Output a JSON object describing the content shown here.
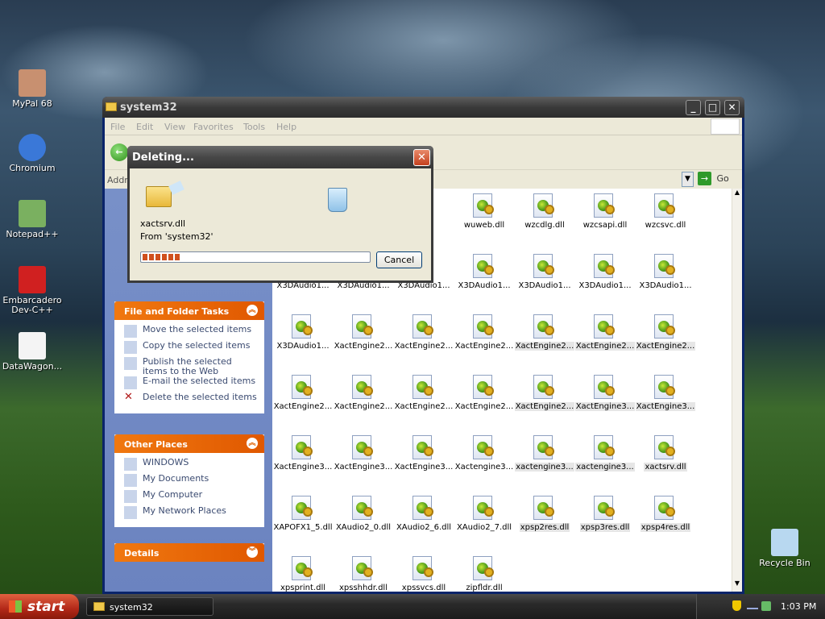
{
  "desktop": {
    "icons": [
      {
        "label": "MyPal 68",
        "icon": "mypal-icon"
      },
      {
        "label": "Chromium",
        "icon": "chromium-icon"
      },
      {
        "label": "Notepad++",
        "icon": "notepadpp-icon"
      },
      {
        "label": "Embarcadero Dev-C++",
        "icon": "devcpp-icon"
      },
      {
        "label": "DataWagon...",
        "icon": "datawagon-icon"
      },
      {
        "label": "Recycle Bin",
        "icon": "recycle-bin-icon"
      }
    ]
  },
  "window": {
    "title": "system32",
    "menu": [
      "File",
      "Edit",
      "View",
      "Favorites",
      "Tools",
      "Help"
    ],
    "address_label": "Addre",
    "go_label": "Go"
  },
  "tasks": {
    "file_folder": {
      "title": "File and Folder Tasks",
      "items": [
        "Move the selected items",
        "Copy the selected items",
        "Publish the selected items to the Web",
        "E-mail the selected items",
        "Delete the selected items"
      ]
    },
    "other_places": {
      "title": "Other Places",
      "items": [
        "WINDOWS",
        "My Documents",
        "My Computer",
        "My Network Places"
      ]
    },
    "details": {
      "title": "Details"
    }
  },
  "files": {
    "rows": [
      [
        "",
        "",
        "",
        "wuweb.dll",
        "wzcdlg.dll",
        "wzcsapi.dll",
        "wzcsvc.dll"
      ],
      [
        "X3DAudio1...",
        "X3DAudio1...",
        "X3DAudio1...",
        "X3DAudio1...",
        "X3DAudio1...",
        "X3DAudio1...",
        "X3DAudio1..."
      ],
      [
        "X3DAudio1...",
        "XactEngine2...",
        "XactEngine2...",
        "XactEngine2...",
        "XactEngine2...",
        "XactEngine2...",
        "XactEngine2..."
      ],
      [
        "XactEngine2...",
        "XactEngine2...",
        "XactEngine2...",
        "XactEngine2...",
        "XactEngine2...",
        "XactEngine3...",
        "XactEngine3..."
      ],
      [
        "XactEngine3...",
        "XactEngine3...",
        "XactEngine3...",
        "Xactengine3...",
        "xactengine3...",
        "xactengine3...",
        "xactsrv.dll"
      ],
      [
        "XAPOFX1_5.dll",
        "XAudio2_0.dll",
        "XAudio2_6.dll",
        "XAudio2_7.dll",
        "xpsp2res.dll",
        "xpsp3res.dll",
        "xpsp4res.dll"
      ],
      [
        "xpsprint.dll",
        "xpsshhdr.dll",
        "xpssvcs.dll",
        "zipfldr.dll"
      ]
    ],
    "selected": [
      [
        2,
        4
      ],
      [
        2,
        5
      ],
      [
        2,
        6
      ],
      [
        3,
        4
      ],
      [
        3,
        5
      ],
      [
        3,
        6
      ],
      [
        4,
        4
      ],
      [
        4,
        5
      ],
      [
        4,
        6
      ],
      [
        5,
        4
      ],
      [
        5,
        5
      ],
      [
        5,
        6
      ]
    ]
  },
  "dialog": {
    "title": "Deleting...",
    "filename": "xactsrv.dll",
    "from": "From 'system32'",
    "cancel_label": "Cancel",
    "progress": 0.17
  },
  "taskbar": {
    "start_label": "start",
    "window_label": "system32",
    "clock": "1:03 PM"
  }
}
